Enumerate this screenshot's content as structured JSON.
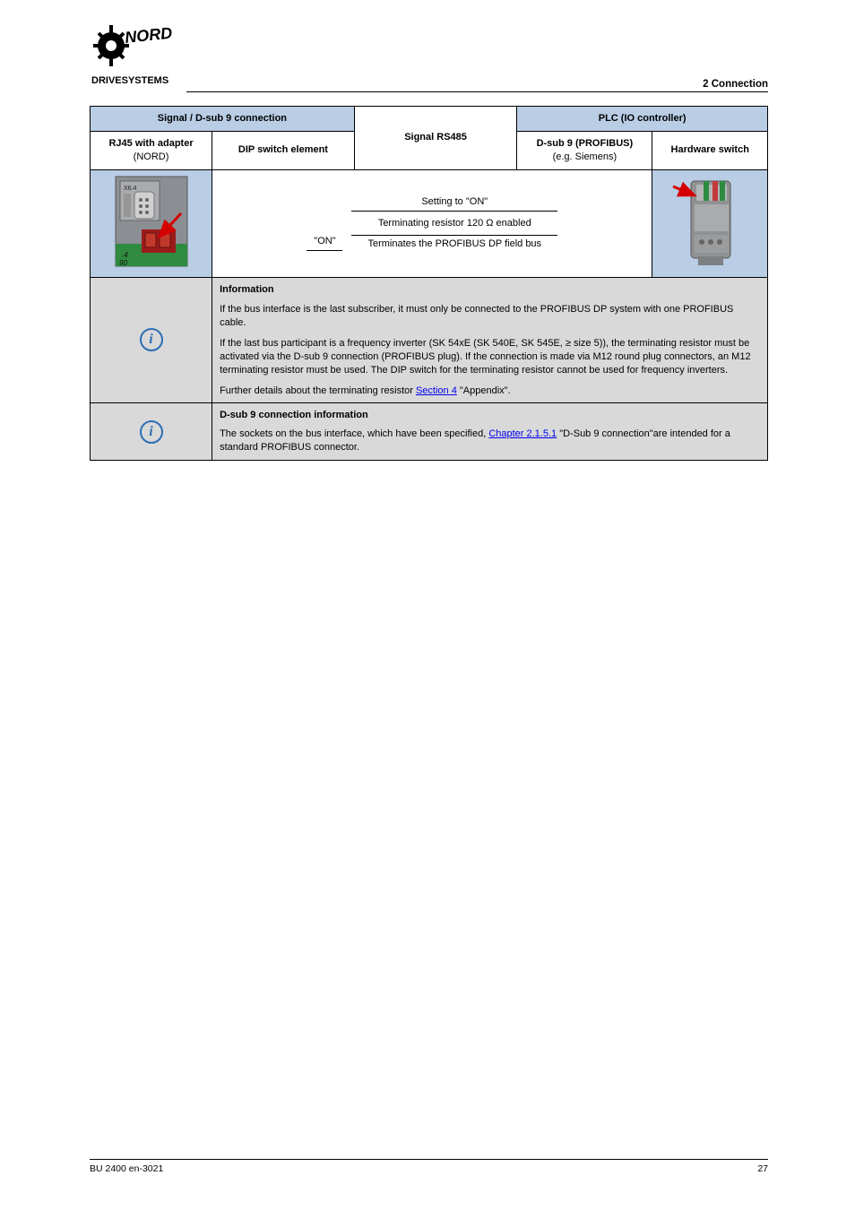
{
  "section_title": "2 Connection",
  "table": {
    "header_row1": {
      "col_a": "Signal / D-sub 9 connection",
      "col_b": "Signal RS485",
      "col_c": "PLC (IO controller)"
    },
    "header_row2": {
      "col_a1_line1": "RJ45 with adapter",
      "col_a1_line2": "(NORD)",
      "col_a2": "DIP switch element",
      "col_c1_line1": "D-sub 9 (PROFIBUS)",
      "col_c1_line2": "(e.g. Siemens)",
      "col_c2": "Hardware switch"
    },
    "row_mid": {
      "dip1": "\"ON\"",
      "line_top": "Setting to \"ON\"",
      "line_mid": "Terminating resistor 120 Ω enabled",
      "line_bot": "Terminates the PROFIBUS DP field bus"
    },
    "note1": {
      "title": "Information",
      "p1": "If the bus interface is the last subscriber, it must only be connected to the PROFIBUS DP system with one PROFIBUS cable.",
      "p2a": "If the last bus participant is a frequency inverter (SK 54xE (SK 540E, SK 545E, ≥ size 5)), the terminating resistor must be activated via the D-sub 9 connection (PROFIBUS plug). ",
      "p2b": "If the connection is made via M12 round plug connectors, an M12 terminating resistor must be used. ",
      "p2c": "The DIP switch for the terminating resistor cannot be used for frequency inverters.",
      "p3a": "Further details about the terminating resistor ",
      "p3_link": "Section 4",
      "p3b": " \"Appendix\"."
    },
    "note2": {
      "title": "D-sub 9 connection information",
      "p1a": "The sockets on the bus interface, which have been specified, ",
      "p1_link": "Chapter 2.1.5.1",
      "p1b": " \"D-Sub 9 connection\"are intended for a standard PROFIBUS connector."
    }
  },
  "footer": {
    "left": "BU 2400 en-3021",
    "right": "27"
  }
}
